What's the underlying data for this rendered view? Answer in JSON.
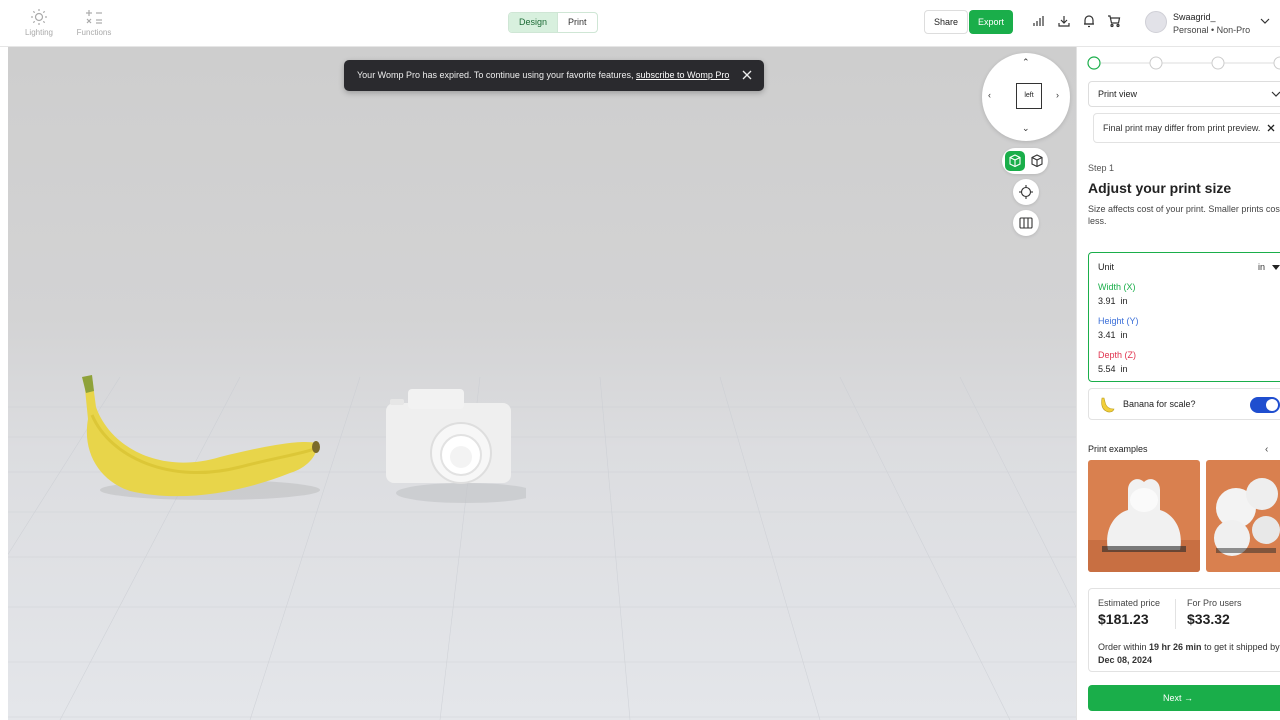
{
  "toolbar": {
    "tools": [
      {
        "label": "Lighting",
        "icon": "sun-icon"
      },
      {
        "label": "Functions",
        "icon": "functions-icon"
      }
    ],
    "mode_tabs": [
      {
        "label": "Design",
        "active": true
      },
      {
        "label": "Print",
        "active": false
      }
    ],
    "share_label": "Share",
    "export_label": "Export",
    "icons": [
      "signal-bars-icon",
      "download-icon",
      "bell-icon",
      "cart-icon"
    ],
    "user": {
      "name": "Swaagrid_",
      "plan": "Personal • Non-Pro"
    }
  },
  "toast": {
    "text": "Your Womp Pro has expired. To continue using your favorite features, ",
    "link": "subscribe to Womp Pro"
  },
  "navcube": {
    "face_label": "left"
  },
  "panel": {
    "view_select": "Print view",
    "notice": "Final print may differ from print preview.",
    "step_label": "Step 1",
    "step_title": "Adjust your print size",
    "step_desc": "Size affects cost of your print. Smaller prints cost less.",
    "unit_label": "Unit",
    "unit_value": "in",
    "dimensions": [
      {
        "label": "Width (X)",
        "value": "3.91",
        "unit": "in",
        "color": "#1aae4a"
      },
      {
        "label": "Height (Y)",
        "value": "3.41",
        "unit": "in",
        "color": "#3b6fd8"
      },
      {
        "label": "Depth (Z)",
        "value": "5.54",
        "unit": "in",
        "color": "#e0334e"
      }
    ],
    "banana_label": "Banana for scale?",
    "banana_on": true,
    "examples_label": "Print examples",
    "price_label": "Estimated price",
    "price_value": "$181.23",
    "pro_label": "For Pro users",
    "pro_value": "$33.32",
    "order_prefix": "Order within ",
    "order_time": "19 hr 26 min",
    "order_mid": " to get it shipped by ",
    "order_date": "Dec 08, 2024",
    "next_label": "Next →"
  },
  "colors": {
    "accent": "#1aae4a",
    "toggle": "#1f4ecf"
  }
}
